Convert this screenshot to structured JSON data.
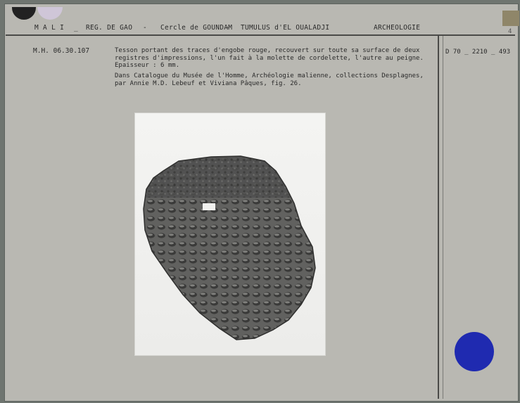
{
  "header": {
    "country": "M A L I",
    "sep1": "_",
    "region": "REG. DE GAO",
    "sep2": "-",
    "cercle": "Cercle de GOUNDAM",
    "sep3": "-",
    "site": "TUMULUS d'EL OUALADJI",
    "category": "ARCHEOLOGIE"
  },
  "reference": "M.H. 06.30.107",
  "catalog_number": "D  70 _ 2210 _ 493",
  "description": "Tesson portant des traces d'engobe rouge, recouvert sur toute sa surface de deux\nregistres d'impressions, l'un fait à la molette de cordelette, l'autre au peigne.\nEpaisseur : 6 mm.",
  "bibliography": "Dans Catalogue du Musée de l'Homme, Archéologie malienne, collections Desplagnes,\npar Annie M.D. Lebeuf et Viviana Pâques, fig. 26.",
  "corner_mark": "4",
  "colors": {
    "card": "#b9b8b2",
    "blue_dot": "#1f2ab0",
    "sherd": "#5a5a58"
  }
}
